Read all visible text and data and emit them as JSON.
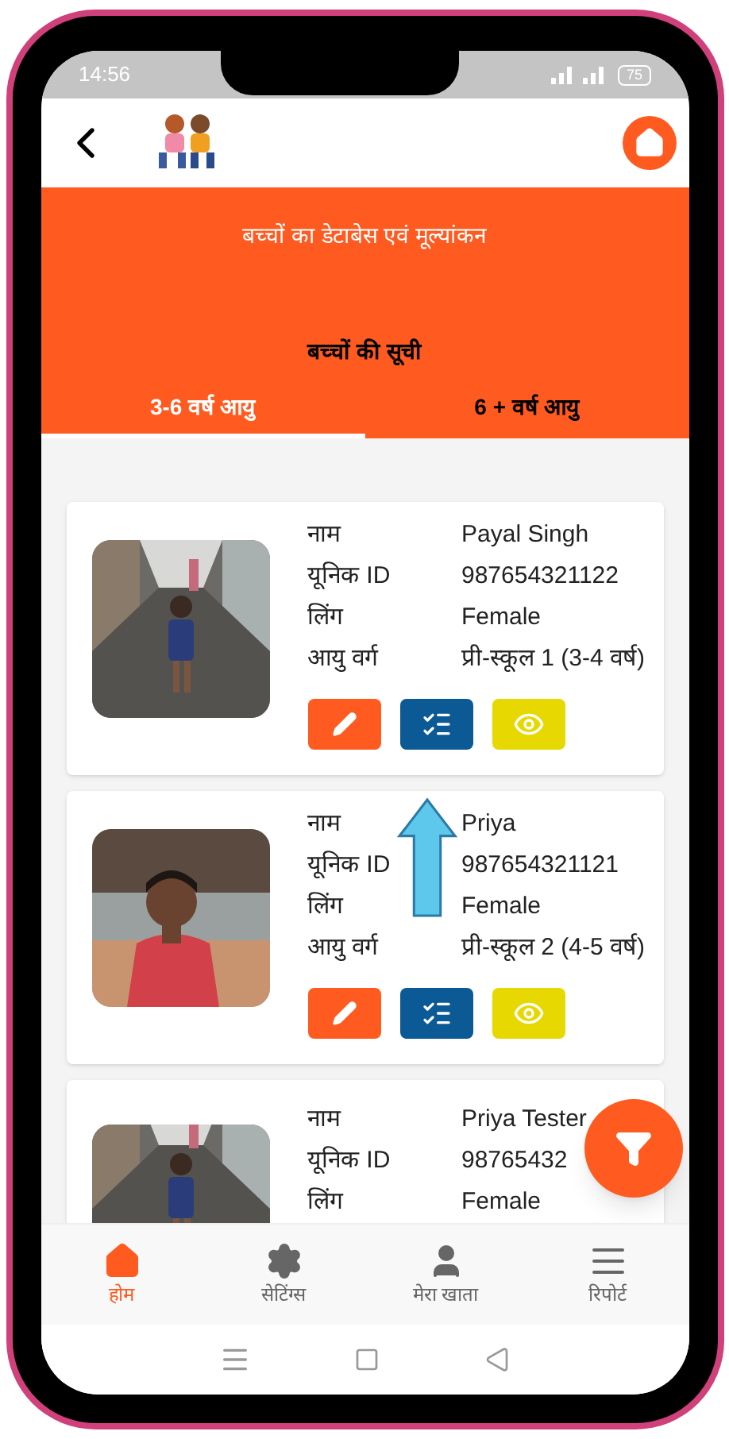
{
  "status_bar": {
    "time": "14:56",
    "battery": "75"
  },
  "header": {
    "title": "बच्चों का  डेटाबेस एवं मूल्यांकन",
    "subtitle": "बच्चों की सूची"
  },
  "tabs": [
    {
      "label": "3-6 वर्ष आयु",
      "selected": true
    },
    {
      "label": "6 + वर्ष आयु",
      "selected": false
    }
  ],
  "children": [
    {
      "kind": "picture",
      "fields": [
        {
          "label": "नाम",
          "value": "Payal Singh"
        },
        {
          "label": "यूनिक ID",
          "value": "987654321122"
        },
        {
          "label": "लिंग",
          "value": "Female"
        },
        {
          "label": "आयु वर्ग",
          "value": "प्री-स्कूल 1 (3-4 वर्ष)"
        }
      ]
    },
    {
      "kind": "picture",
      "fields": [
        {
          "label": "नाम",
          "value": "Priya"
        },
        {
          "label": "यूनिक ID",
          "value": "987654321121"
        },
        {
          "label": "लिंग",
          "value": "Female"
        },
        {
          "label": "आयु वर्ग",
          "value": "प्री-स्कूल 2 (4-5 वर्ष)"
        }
      ]
    },
    {
      "kind": "picture",
      "fields": [
        {
          "label": "नाम",
          "value": "Priya Tester"
        },
        {
          "label": "यूनिक ID",
          "value": "98765432"
        },
        {
          "label": "लिंग",
          "value": "Female"
        }
      ]
    }
  ],
  "bottom_nav": [
    {
      "label": "होम",
      "selected": true
    },
    {
      "label": "सेटिंग्स",
      "selected": false
    },
    {
      "label": "मेरा खाता",
      "selected": false
    },
    {
      "label": "रिपोर्ट",
      "selected": false
    }
  ]
}
